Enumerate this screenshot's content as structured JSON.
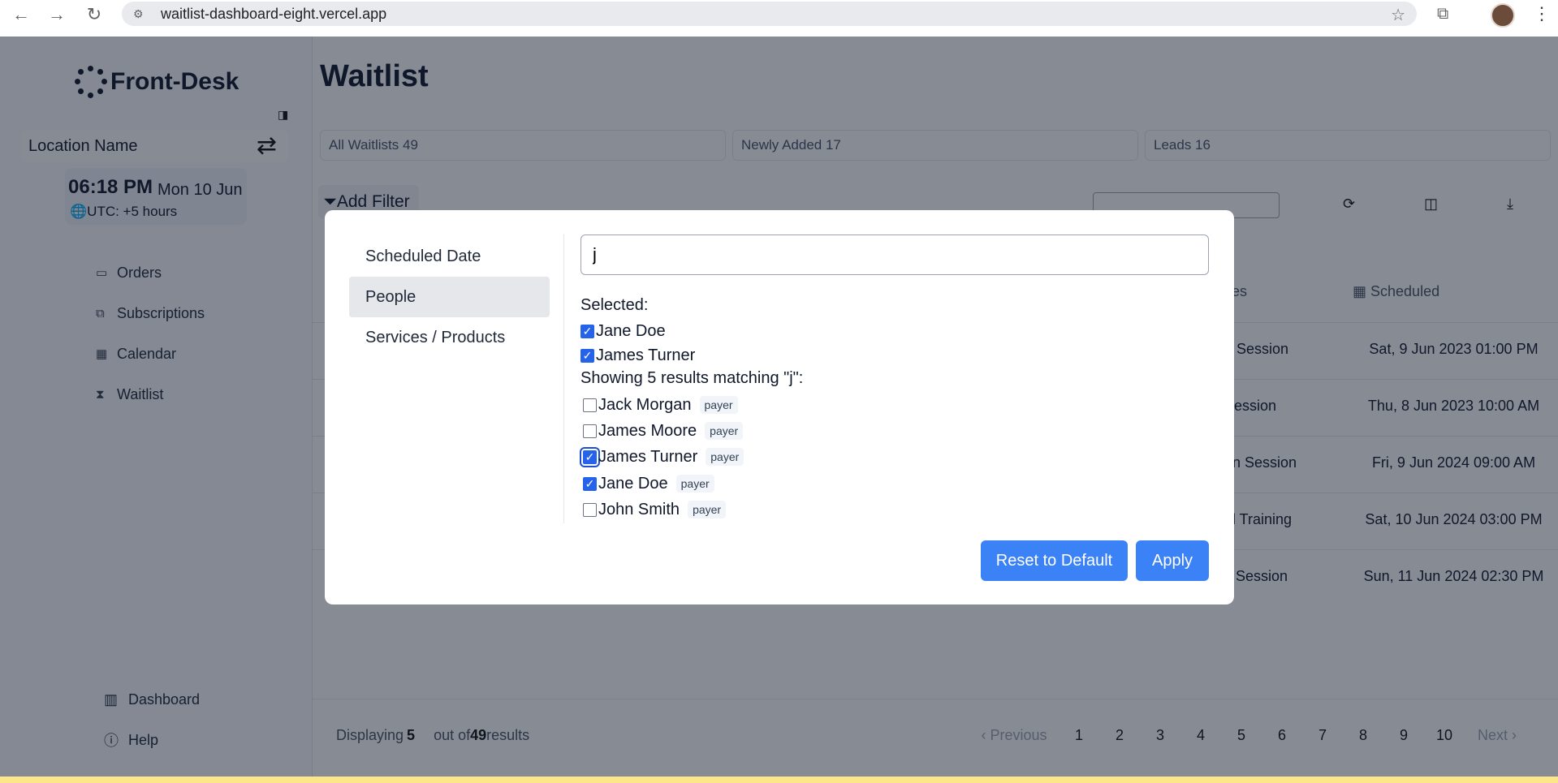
{
  "browser": {
    "url": "waitlist-dashboard-eight.vercel.app"
  },
  "sidebar": {
    "logo": "Front-Desk",
    "location": "Location Name",
    "time": "06:18 PM",
    "date": "Mon 10 Jun",
    "timezone": "UTC: +5 hours",
    "items": [
      {
        "label": "Orders",
        "icon": "orders-icon"
      },
      {
        "label": "Subscriptions",
        "icon": "subscriptions-icon"
      },
      {
        "label": "Calendar",
        "icon": "calendar-icon"
      },
      {
        "label": "Waitlist",
        "icon": "hourglass-icon"
      }
    ],
    "bottom": [
      {
        "label": "Dashboard",
        "icon": "dashboard-icon"
      },
      {
        "label": "Help",
        "icon": "help-icon"
      }
    ]
  },
  "main": {
    "title": "Waitlist",
    "stats": [
      "All Waitlists 49",
      "Newly Added 17",
      "Leads 16"
    ],
    "add_filter": "Add Filter",
    "columns": {
      "services": "ces",
      "scheduled": "Scheduled"
    },
    "rows": [
      {
        "service": "e Session",
        "scheduled": "Sat, 9 Jun 2023 01:00 PM"
      },
      {
        "service": "Session",
        "scheduled": "Thu, 8 Jun 2023 10:00 AM"
      },
      {
        "service": "on Session",
        "scheduled": "Fri, 9 Jun 2024 09:00 AM"
      },
      {
        "service": "al Training",
        "scheduled": "Sat, 10 Jun 2024 03:00 PM"
      },
      {
        "service": "s Session",
        "scheduled": "Sun, 11 Jun 2024 02:30 PM"
      }
    ],
    "footer": {
      "displaying": "Displaying",
      "count": "5",
      "out_of": "out of",
      "total": "49",
      "results": "results",
      "previous": "Previous",
      "next": "Next",
      "pages": [
        "1",
        "2",
        "3",
        "4",
        "5",
        "6",
        "7",
        "8",
        "9",
        "10"
      ]
    }
  },
  "modal": {
    "categories": [
      "Scheduled Date",
      "People",
      "Services / Products"
    ],
    "active_category": "People",
    "search_value": "j",
    "selected_label": "Selected:",
    "selected": [
      "Jane Doe",
      "James Turner"
    ],
    "results_label": "Showing 5 results matching \"j\":",
    "results": [
      {
        "name": "Jack Morgan",
        "tag": "payer",
        "checked": false
      },
      {
        "name": "James Moore",
        "tag": "payer",
        "checked": false
      },
      {
        "name": "James Turner",
        "tag": "payer",
        "checked": true
      },
      {
        "name": "Jane Doe",
        "tag": "payer",
        "checked": true
      },
      {
        "name": "John Smith",
        "tag": "payer",
        "checked": false
      }
    ],
    "reset_label": "Reset to Default",
    "apply_label": "Apply"
  },
  "colors": {
    "accent": "#3b82f6",
    "checkbox": "#2563eb"
  }
}
